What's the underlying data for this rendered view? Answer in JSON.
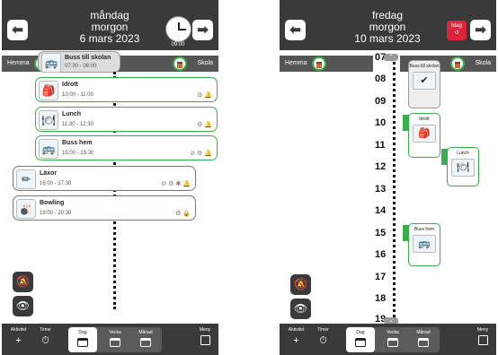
{
  "left": {
    "header": {
      "prev": "⬅",
      "next": "➡",
      "day": "måndag",
      "part": "morgon",
      "date": "6 mars 2023",
      "clock_time": "09:00"
    },
    "placebar": {
      "from": "Hemma",
      "to": "Skola"
    },
    "activities": [
      {
        "title": "Buss till skolan",
        "time": "07:30 - 08:00",
        "icon": "bus-icon"
      },
      {
        "title": "Idrott",
        "time": "10:00 - 11:00",
        "icon": "sportsbag-icon"
      },
      {
        "title": "Lunch",
        "time": "11:30 - 12:30",
        "icon": "lunch-icon"
      },
      {
        "title": "Buss hem",
        "time": "15:00 - 15:30",
        "icon": "bus-icon"
      },
      {
        "title": "Läxor",
        "time": "16:00 - 17:30",
        "icon": "homework-icon"
      },
      {
        "title": "Bowling",
        "time": "19:00 - 20:30",
        "icon": "bowling-icon"
      }
    ]
  },
  "right": {
    "header": {
      "prev": "⬅",
      "next": "➡",
      "day": "fredag",
      "part": "morgon",
      "date": "10 mars 2023",
      "today_label": "Idag"
    },
    "placebar": {
      "from": "Hemma",
      "to": "Skola"
    },
    "hours": [
      "07",
      "08",
      "09",
      "10",
      "11",
      "12",
      "13",
      "14",
      "15",
      "16",
      "17",
      "18",
      "19"
    ],
    "activities": [
      {
        "title": "Buss till skolan"
      },
      {
        "title": "Idrott"
      },
      {
        "title": "Lunch"
      },
      {
        "title": "Buss hem"
      }
    ]
  },
  "toolbar": {
    "activity": "Aktivitet",
    "timer": "Timer",
    "day": "Dag",
    "week": "Vecka",
    "month": "Månad",
    "menu": "Meny"
  },
  "colors": {
    "accent_green": "#3aae4a",
    "header_bg": "#3a3a3a",
    "today_red": "#d9263b"
  }
}
